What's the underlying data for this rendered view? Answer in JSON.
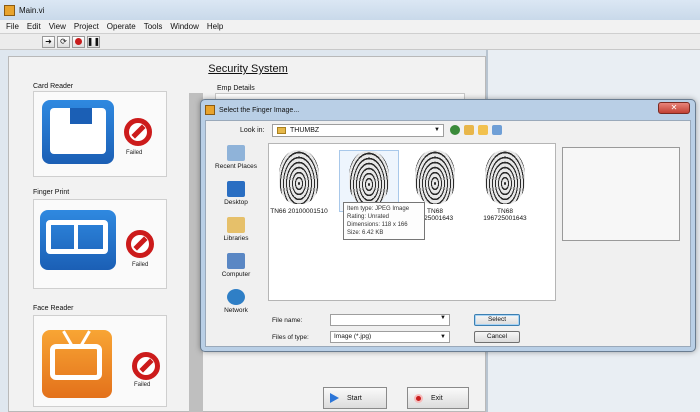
{
  "window": {
    "title": "Main.vi"
  },
  "menu": [
    "File",
    "Edit",
    "View",
    "Project",
    "Operate",
    "Tools",
    "Window",
    "Help"
  ],
  "toolbar": {
    "icons": [
      "run-arrow-icon",
      "run-continuous-icon",
      "abort-icon",
      "pause-icon"
    ]
  },
  "panel": {
    "title": "Security System",
    "sections": [
      {
        "label": "Card Reader",
        "status": "Failed",
        "icon": "floppy-icon"
      },
      {
        "label": "Finger Print",
        "status": "Failed",
        "icon": "film-strip-icon"
      },
      {
        "label": "Face Reader",
        "status": "Failed",
        "icon": "tv-icon"
      }
    ],
    "emp_details_label": "Emp Details",
    "start_label": "Start",
    "exit_label": "Exit"
  },
  "dialog": {
    "title": "Select the Finger Image...",
    "look_in_label": "Look in:",
    "look_in_value": "THUMBZ",
    "places": [
      "Recent Places",
      "Desktop",
      "Libraries",
      "Computer",
      "Network"
    ],
    "files": [
      {
        "name": "TN66 20100001510"
      },
      {
        "name": ""
      },
      {
        "name": "TN68 196725001643"
      },
      {
        "name": "TN68 196725001643"
      }
    ],
    "file3_partial": "TN68",
    "file3_partial2": "6725001643",
    "tooltip": {
      "line1": "Item type: JPEG Image",
      "line2": "Rating: Unrated",
      "line3": "Dimensions: 118 x 166",
      "line4": "Size: 6.42 KB"
    },
    "file_name_label": "File name:",
    "file_name_value": "",
    "file_type_label": "Files of type:",
    "file_type_value": "Image (*.jpg)",
    "select_label": "Select",
    "cancel_label": "Cancel"
  },
  "colors": {
    "accent_blue": "#2f89e0",
    "accent_orange": "#f8a534",
    "stop_red": "#cc1b1b"
  }
}
